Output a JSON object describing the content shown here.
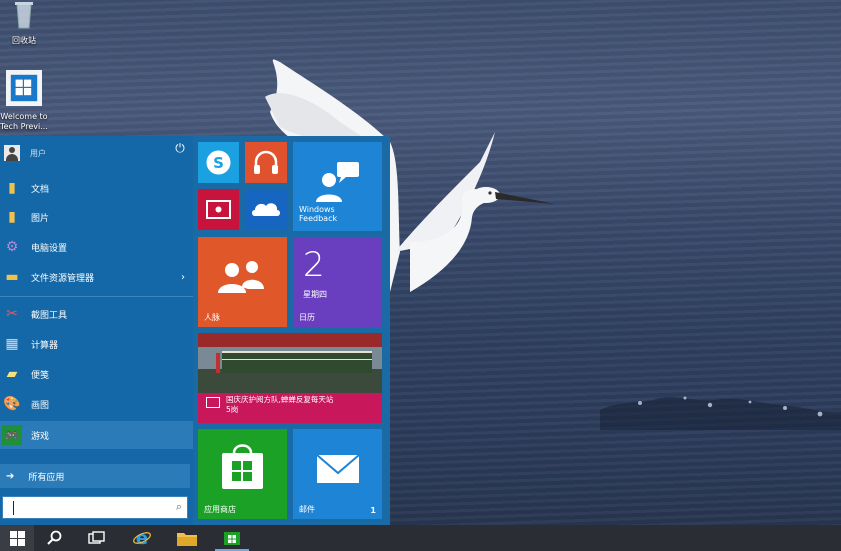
{
  "desktop": {
    "icons": [
      {
        "name": "recycle-bin",
        "label": "回收站"
      },
      {
        "name": "welcome",
        "label": "Welcome to Tech Previ..."
      }
    ]
  },
  "start_menu": {
    "user": {
      "name": "用户"
    },
    "items": [
      {
        "label": "文档",
        "icon": "documents-icon"
      },
      {
        "label": "图片",
        "icon": "pictures-icon"
      },
      {
        "label": "电脑设置",
        "icon": "settings-icon"
      },
      {
        "label": "文件资源管理器",
        "icon": "file-explorer-icon",
        "has_submenu": true
      },
      {
        "label": "截图工具",
        "icon": "snipping-tool-icon"
      },
      {
        "label": "计算器",
        "icon": "calculator-icon"
      },
      {
        "label": "便笺",
        "icon": "sticky-notes-icon"
      },
      {
        "label": "画图",
        "icon": "paint-icon"
      },
      {
        "label": "游戏",
        "icon": "games-icon"
      }
    ],
    "all_apps": "所有应用",
    "tiles": {
      "feedback": "Windows Feedback",
      "people": "人脉",
      "calendar_day": "2",
      "calendar_weekday": "星期四",
      "calendar": "日历",
      "news_headline": "国庆庆护阅方队,蝉蝉反复每天站",
      "news_headline2": "5岗",
      "store": "应用商店",
      "mail": "邮件",
      "mail_count": "1"
    }
  },
  "colors": {
    "start_bg": "#1a6aa6",
    "skype": "#1ba1e2",
    "music": "#e0522e",
    "video": "#c8143c",
    "onedrive": "#1665c0",
    "feedback": "#1e84d6",
    "people": "#e0582a",
    "calendar": "#6a3fbf",
    "news": "#c8175a",
    "store": "#1aa126",
    "mail": "#1e84d6"
  }
}
